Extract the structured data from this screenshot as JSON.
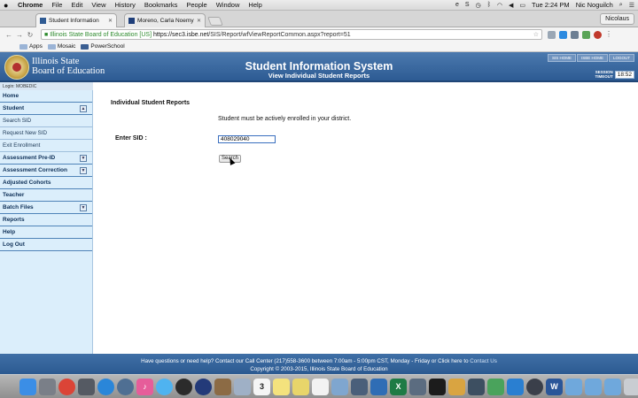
{
  "menubar": {
    "apple": "",
    "items": [
      "Chrome",
      "File",
      "Edit",
      "View",
      "History",
      "Bookmarks",
      "People",
      "Window",
      "Help"
    ],
    "clock": "Tue 2:24 PM",
    "user": "Nic Noguilch"
  },
  "tabs": [
    {
      "label": "Student Information",
      "color": "#2f5b93"
    },
    {
      "label": "Moreno, Carla Noemy",
      "color": "#1f3f7a"
    }
  ],
  "profile": "Nicolaus",
  "omnibox": {
    "org": "Illinois State Board of Education [US]",
    "scheme": "https://",
    "host": "sec3.isbe.net",
    "path": "/SIS/Report/wfViewReportCommon.aspx?report=51"
  },
  "bookmarks": [
    {
      "label": "Apps"
    },
    {
      "label": "Mosaic"
    },
    {
      "label": "PowerSchool"
    }
  ],
  "header": {
    "logo_line1": "Illinois State",
    "logo_line2": "Board of Education",
    "title": "Student Information System",
    "subtitle": "View Individual Student Reports",
    "toplinks": [
      "SIS HOME",
      "ISBE HOME",
      "LOGOUT"
    ],
    "timeout_label1": "SESSION",
    "timeout_label2": "TIMEOUT",
    "timeout_value": "18:52"
  },
  "login": "Login: MOBEDIC",
  "sidebar": [
    {
      "label": "Home",
      "kind": "head",
      "arrow": false
    },
    {
      "label": "Student",
      "kind": "head",
      "arrow": true,
      "arrow_glyph": "▲"
    },
    {
      "label": "Search SID",
      "kind": "sub",
      "arrow": false
    },
    {
      "label": "Request New SID",
      "kind": "sub",
      "arrow": false
    },
    {
      "label": "Exit Enrollment",
      "kind": "sub",
      "arrow": false
    },
    {
      "label": "Assessment Pre-ID",
      "kind": "head",
      "arrow": true,
      "arrow_glyph": "▼"
    },
    {
      "label": "Assessment Correction",
      "kind": "head",
      "arrow": true,
      "arrow_glyph": "▼"
    },
    {
      "label": "Adjusted Cohorts",
      "kind": "head",
      "arrow": false
    },
    {
      "label": "Teacher",
      "kind": "head",
      "arrow": false
    },
    {
      "label": "Batch Files",
      "kind": "head",
      "arrow": true,
      "arrow_glyph": "▼"
    },
    {
      "label": "Reports",
      "kind": "head",
      "arrow": false
    },
    {
      "label": "Help",
      "kind": "head",
      "arrow": false
    },
    {
      "label": "Log Out",
      "kind": "head",
      "arrow": false
    }
  ],
  "main": {
    "report_title": "Individual Student Reports",
    "notice": "Student must be actively enrolled in your district.",
    "sid_label": "Enter SID :",
    "sid_value": "408029040",
    "search_label": "Search"
  },
  "footer": {
    "line1_pre": "Have questions or need help? Contact our Call Center (217)558-3600 between 7:00am - 5:00pm CST, Monday - Friday or Click here to",
    "line1_link": "Contact Us",
    "line2": "Copyright © 2003-2015, Illinois State Board of Education"
  },
  "dock": [
    {
      "name": "finder-icon",
      "color": "#3b8ee6",
      "glyph": ""
    },
    {
      "name": "launchpad-icon",
      "color": "#7a7f88",
      "glyph": ""
    },
    {
      "name": "chrome-icon",
      "color": "#db4437",
      "glyph": ""
    },
    {
      "name": "app-grid-icon",
      "color": "#555a63",
      "glyph": ""
    },
    {
      "name": "safari-icon",
      "color": "#2a86d9",
      "glyph": ""
    },
    {
      "name": "compass-icon",
      "color": "#4f6f93",
      "glyph": ""
    },
    {
      "name": "itunes-icon",
      "color": "#e65d9a",
      "glyph": "♪"
    },
    {
      "name": "messages-icon",
      "color": "#4fb3f0",
      "glyph": ""
    },
    {
      "name": "owl-icon",
      "color": "#2b2b2b",
      "glyph": ""
    },
    {
      "name": "flag-icon",
      "color": "#233a79",
      "glyph": ""
    },
    {
      "name": "photos-icon",
      "color": "#8c6b45",
      "glyph": ""
    },
    {
      "name": "mail-icon",
      "color": "#9fb0c6",
      "glyph": ""
    },
    {
      "name": "calendar-icon",
      "color": "#f5f5f5",
      "glyph": "3"
    },
    {
      "name": "notes-icon",
      "color": "#f4e27d",
      "glyph": ""
    },
    {
      "name": "stickies-icon",
      "color": "#e8d56a",
      "glyph": ""
    },
    {
      "name": "reminders-icon",
      "color": "#f2f2f2",
      "glyph": ""
    },
    {
      "name": "preview-icon",
      "color": "#7fa6cf",
      "glyph": ""
    },
    {
      "name": "screenshot-icon",
      "color": "#4a5f7a",
      "glyph": ""
    },
    {
      "name": "keynote-icon",
      "color": "#2f6db5",
      "glyph": ""
    },
    {
      "name": "excel-icon",
      "color": "#1e7b45",
      "glyph": "X"
    },
    {
      "name": "image-icon",
      "color": "#5b6c80",
      "glyph": ""
    },
    {
      "name": "terminal-icon",
      "color": "#1c1c1c",
      "glyph": ""
    },
    {
      "name": "contacts-icon",
      "color": "#d9a441",
      "glyph": ""
    },
    {
      "name": "activity-icon",
      "color": "#3d4f61",
      "glyph": ""
    },
    {
      "name": "vpn-icon",
      "color": "#4aa35c",
      "glyph": ""
    },
    {
      "name": "teamviewer-icon",
      "color": "#2a7fd1",
      "glyph": ""
    },
    {
      "name": "quicktime-icon",
      "color": "#3a3f4a",
      "glyph": ""
    },
    {
      "name": "word-icon",
      "color": "#2a5699",
      "glyph": "W"
    },
    {
      "name": "folder-icon",
      "color": "#6fa8dc",
      "glyph": ""
    },
    {
      "name": "downloads-folder-icon",
      "color": "#6fa8dc",
      "glyph": ""
    },
    {
      "name": "documents-folder-icon",
      "color": "#6fa8dc",
      "glyph": ""
    },
    {
      "name": "trash-icon",
      "color": "#c9cdd2",
      "glyph": ""
    }
  ]
}
